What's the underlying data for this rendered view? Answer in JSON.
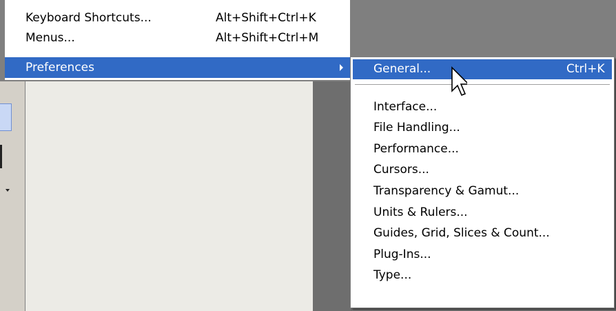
{
  "main_menu": {
    "items": [
      {
        "label": "Keyboard Shortcuts...",
        "shortcut": "Alt+Shift+Ctrl+K"
      },
      {
        "label": "Menus...",
        "shortcut": "Alt+Shift+Ctrl+M"
      },
      {
        "label": "Preferences",
        "shortcut": ""
      }
    ]
  },
  "preferences_submenu": {
    "items": [
      {
        "label": "General...",
        "shortcut": "Ctrl+K"
      },
      {
        "label": "Interface..."
      },
      {
        "label": "File Handling..."
      },
      {
        "label": "Performance..."
      },
      {
        "label": "Cursors..."
      },
      {
        "label": "Transparency & Gamut..."
      },
      {
        "label": "Units & Rulers..."
      },
      {
        "label": "Guides, Grid, Slices & Count..."
      },
      {
        "label": "Plug-Ins..."
      },
      {
        "label": "Type..."
      }
    ]
  },
  "colors": {
    "highlight": "#316ac5",
    "menu_background": "#ffffff",
    "workspace": "#ecebe6",
    "backdrop": "#808080"
  },
  "icons": {
    "submenu_arrow": "triangle-right-icon",
    "cursor": "arrow-pointer-icon"
  }
}
